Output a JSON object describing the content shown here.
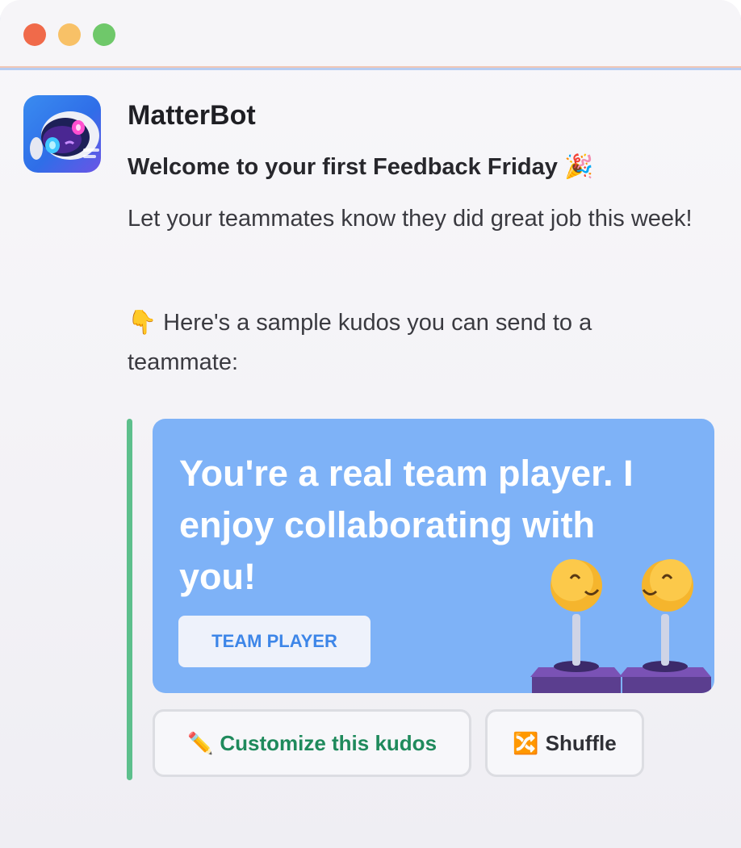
{
  "window": {
    "controls": [
      "close",
      "minimize",
      "zoom"
    ]
  },
  "message": {
    "sender": "MatterBot",
    "avatar_icon": "robot-icon",
    "heading": "Welcome to your first Feedback Friday",
    "heading_emoji": "🎉",
    "intro": "Let your teammates know they did great job this week!",
    "prompt_emoji": "👇",
    "prompt": "Here's a sample kudos you can send to a teammate:"
  },
  "kudos_card": {
    "text": "You're a real team player. I enjoy collaborating with you!",
    "tag": "TEAM PLAYER",
    "background": "#7eb2f7",
    "illustration": "joystick-smileys"
  },
  "actions": {
    "customize_emoji": "✏️",
    "customize_label": "Customize this kudos",
    "shuffle_emoji": "🔀",
    "shuffle_label": "Shuffle"
  },
  "colors": {
    "accent_green": "#5dbf8c",
    "customize_text": "#1f8a5c",
    "tag_text": "#3d86e8"
  }
}
